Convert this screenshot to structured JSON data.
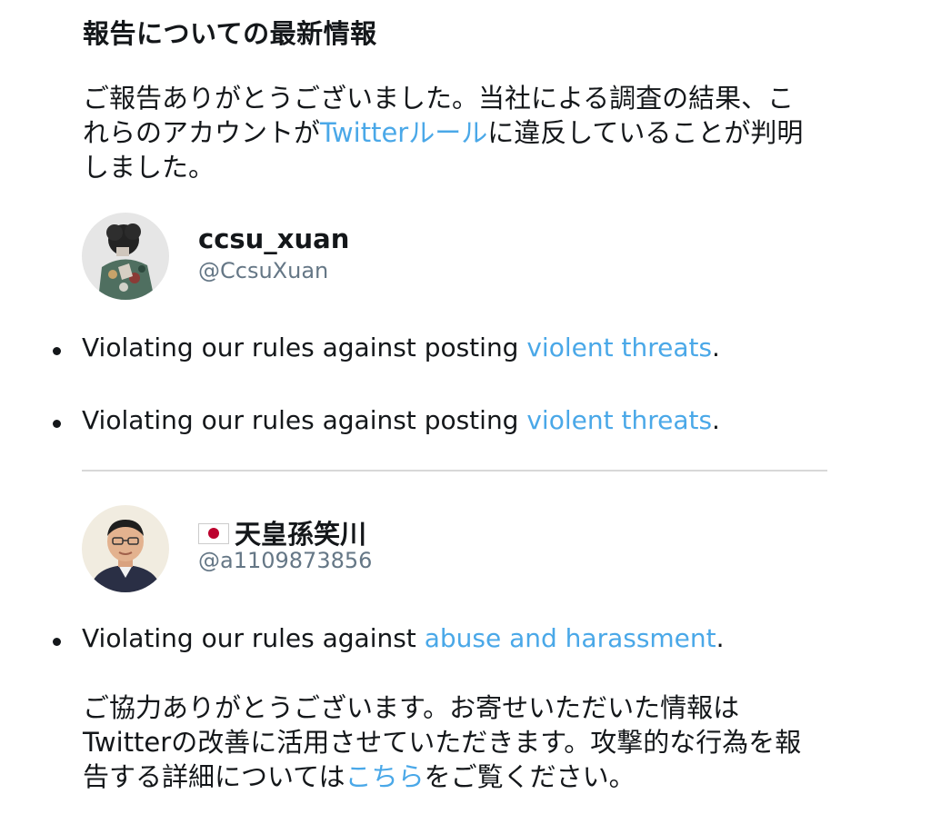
{
  "heading": "報告についての最新情報",
  "intro": {
    "text_before": "ご報告ありがとうございました。当社による調査の結果、これらのアカウントが",
    "link": "Twitterルール",
    "text_after": "に違反していることが判明しました。"
  },
  "accounts": [
    {
      "display_name": "ccsu_xuan",
      "handle": "@CcsuXuan",
      "violations": [
        {
          "prefix": "Violating our rules against posting ",
          "link": "violent threats",
          "suffix": "."
        },
        {
          "prefix": "Violating our rules against posting ",
          "link": "violent threats",
          "suffix": "."
        }
      ]
    },
    {
      "flag_icon": "japan-flag-icon",
      "display_name": "天皇孫笑川",
      "handle": "@a1109873856",
      "violations": [
        {
          "prefix": "Violating our rules against ",
          "link": "abuse and harassment",
          "suffix": "."
        }
      ]
    }
  ],
  "closing": {
    "text_before": "ご協力ありがとうございます。お寄せいただいた情報はTwitterの改善に活用させていただきます。攻撃的な行為を報告する詳細については",
    "link": "こちら",
    "text_after": "をご覧ください。"
  },
  "colors": {
    "link": "#4aa8e8",
    "text": "#14171a",
    "handle": "#657786",
    "divider": "#d8d8d8"
  }
}
